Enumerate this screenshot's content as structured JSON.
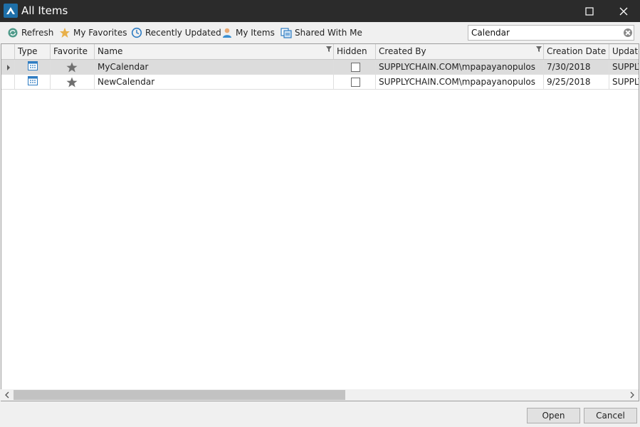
{
  "window": {
    "title": "All Items"
  },
  "toolbar": {
    "refresh": "Refresh",
    "favorites": "My Favorites",
    "recent": "Recently Updated",
    "my_items": "My Items",
    "shared": "Shared With Me"
  },
  "search": {
    "value": "Calendar"
  },
  "grid": {
    "columns": [
      "Type",
      "Favorite",
      "Name",
      "Hidden",
      "Created By",
      "Creation Date",
      "Update"
    ],
    "rows": [
      {
        "name": "MyCalendar",
        "created_by": "SUPPLYCHAIN.COM\\mpapayanopulos",
        "creation_date": "7/30/2018",
        "updated": "SUPPLY",
        "hidden": false,
        "favorite": true,
        "selected": true
      },
      {
        "name": "NewCalendar",
        "created_by": "SUPPLYCHAIN.COM\\mpapayanopulos",
        "creation_date": "9/25/2018",
        "updated": "SUPPLY",
        "hidden": false,
        "favorite": true,
        "selected": false
      }
    ]
  },
  "footer": {
    "open": "Open",
    "cancel": "Cancel"
  },
  "colors": {
    "titlebar": "#2b2b2b",
    "accent": "#1e6fa8",
    "selected_row": "#dcdcdc",
    "star": "#6f6f6f"
  },
  "icons": [
    "app-logo-icon",
    "maximize-icon",
    "close-icon",
    "refresh-icon",
    "star-icon",
    "clock-icon",
    "user-icon",
    "shared-icon",
    "clear-search-icon",
    "filter-icon",
    "calendar-icon",
    "row-indicator-icon",
    "scroll-left-icon",
    "scroll-right-icon"
  ]
}
